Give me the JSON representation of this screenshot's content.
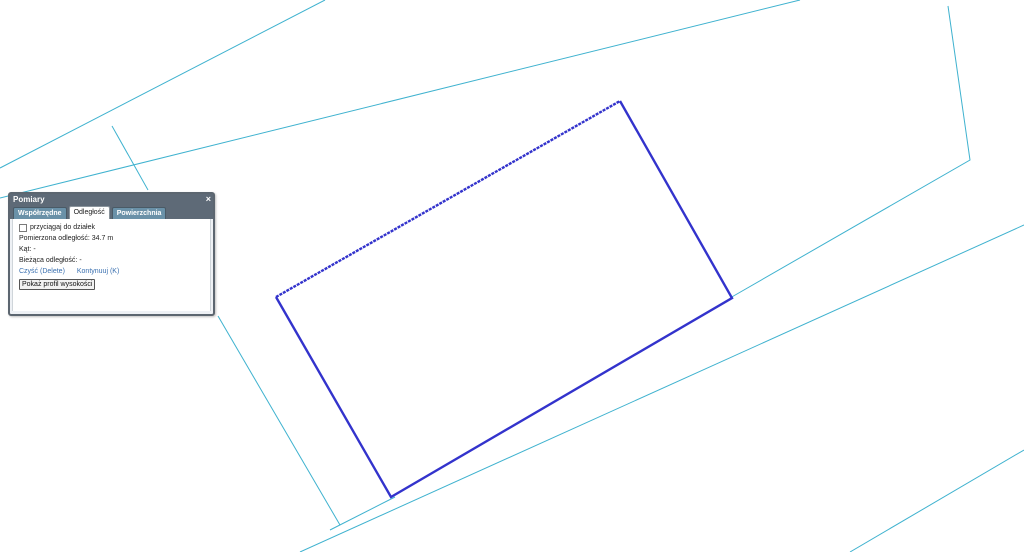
{
  "map": {
    "parcel_line_color": "#3fb2cf",
    "measure_line_color": "#3333cc"
  },
  "panel": {
    "title": "Pomiary",
    "close_icon": "×",
    "tabs": [
      {
        "label": "Współrzędne",
        "active": false
      },
      {
        "label": "Odległość",
        "active": true
      },
      {
        "label": "Powierzchnia",
        "active": false
      }
    ],
    "snap_label": "przyciągaj do działek",
    "measured_label": "Pomierzona odległość: 34.7 m",
    "angle_label": "Kąt: -",
    "current_distance_label": "Bieżąca odległość: -",
    "clear_link": "Czyść (Delete)",
    "continue_link": "Kontynuuj (K)",
    "profile_button": "Pokaż profil wysokości"
  }
}
